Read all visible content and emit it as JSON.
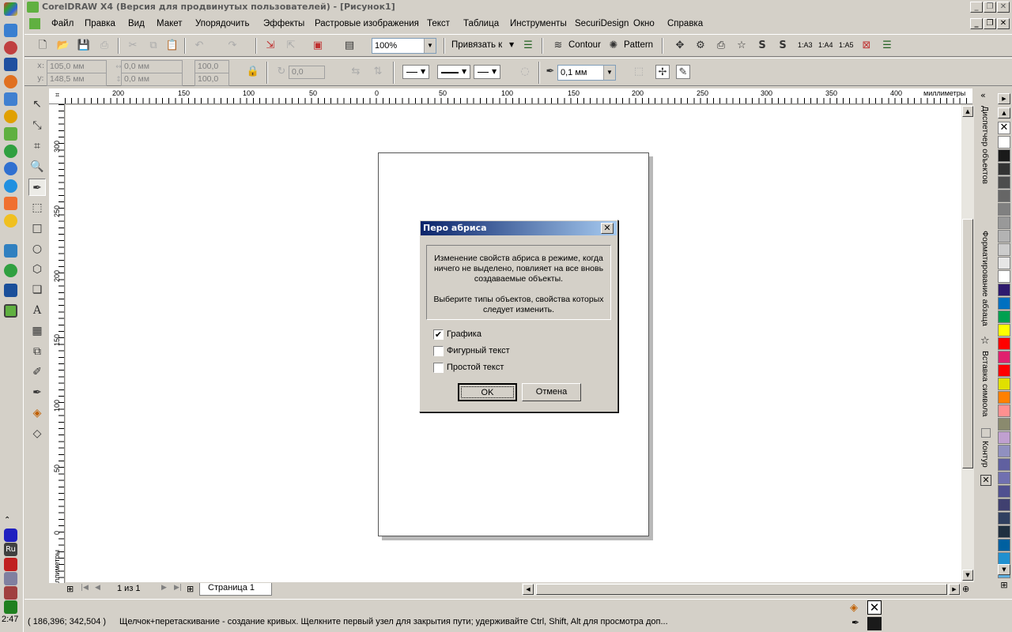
{
  "window": {
    "title": "CorelDRAW X4 (Версия для продвинутых пользователей) - [Рисунок1]"
  },
  "menu": [
    "Файл",
    "Правка",
    "Вид",
    "Макет",
    "Упорядочить",
    "Эффекты",
    "Растровые изображения",
    "Текст",
    "Таблица",
    "Инструменты",
    "SecuriDesign",
    "Окно",
    "Справка"
  ],
  "standard_toolbar": {
    "zoom": "100%",
    "snap_label": "Привязать к",
    "contour_label": "Contour",
    "pattern_label": "Pattern",
    "layout_labels": [
      "1:A3",
      "1:A4",
      "1:A5"
    ]
  },
  "property_bar": {
    "x_label": "x:",
    "y_label": "y:",
    "x": "105,0 мм",
    "y": "148,5 мм",
    "w": "0,0 мм",
    "h": "0,0 мм",
    "scale_x": "100,0",
    "scale_y": "100,0",
    "angle": "0,0",
    "outline_width": "0,1 мм"
  },
  "rulers": {
    "units": "миллиметры",
    "h_labels": [
      "200",
      "150",
      "100",
      "50",
      "0",
      "50",
      "100",
      "150",
      "200",
      "250",
      "300",
      "350",
      "400"
    ],
    "v_labels": [
      "300",
      "250",
      "200",
      "150",
      "100",
      "50",
      "0"
    ]
  },
  "page_nav": {
    "count": "1 из 1",
    "tab": "Страница 1"
  },
  "dockers": [
    "Диспетчер объектов",
    "Форматирование абзаца",
    "Вставка символа",
    "Контур"
  ],
  "palette": [
    "#ffffff",
    "#1a1a1a",
    "#333333",
    "#4d4d4d",
    "#666666",
    "#808080",
    "#999999",
    "#b3b3b3",
    "#cccccc",
    "#e6e6e6",
    "#ffffff",
    "#2e1a6e",
    "#0070c0",
    "#00a050",
    "#ffff00",
    "#ff0000",
    "#e0206e",
    "#ff0000",
    "#e0e000",
    "#ff8000",
    "#ff9090",
    "#8a8a6e",
    "#c0a0d0",
    "#9090c0",
    "#6060a0",
    "#7070b0",
    "#505090",
    "#404070",
    "#304060",
    "#203040",
    "#0060a0",
    "#2090d0",
    "#60b0e0"
  ],
  "status": {
    "coords": "( 186,396; 342,504 )",
    "hint": "Щелчок+перетаскивание - создание кривых. Щелкните первый узел для закрытия пути; удерживайте Ctrl, Shift, Alt для просмотра доп..."
  },
  "taskbar": {
    "clock": "2:47",
    "lang": "Ru"
  },
  "dialog": {
    "title": "Перо абриса",
    "message1": "Изменение свойств абриса в режиме, когда ничего не выделено, повлияет на все вновь создаваемые объекты.",
    "message2": "Выберите типы объектов, свойства которых следует изменить.",
    "options": [
      {
        "label": "Графика",
        "checked": true
      },
      {
        "label": "Фигурный текст",
        "checked": false
      },
      {
        "label": "Простой текст",
        "checked": false
      }
    ],
    "ok": "OK",
    "cancel": "Отмена"
  }
}
